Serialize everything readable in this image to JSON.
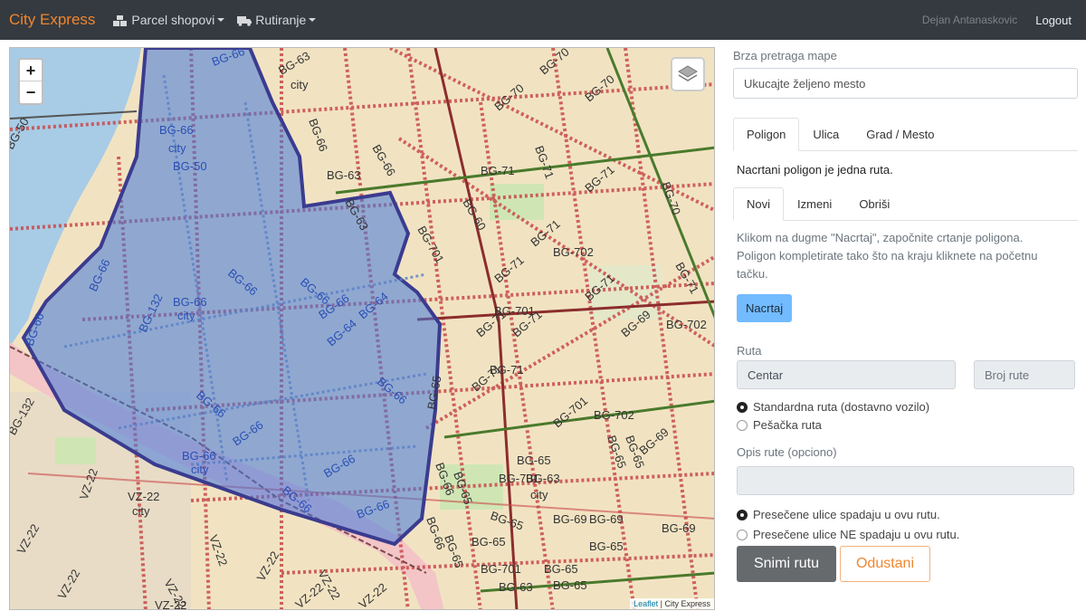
{
  "navbar": {
    "brand": "City Express",
    "menu": [
      {
        "label": "Parcel shopovi",
        "icon": "boxes-icon"
      },
      {
        "label": "Rutiranje",
        "icon": "truck-icon"
      }
    ],
    "user": "Dejan Antanaskovic",
    "logout": "Logout"
  },
  "map": {
    "zoom_in": "+",
    "zoom_out": "−",
    "attribution_link": "Leaflet",
    "attribution_text": " | City Express",
    "route_color": "#3b5ec6",
    "labels": [
      "BG-66",
      "BG-66",
      "BG-66",
      "BG-66",
      "BG-66",
      "BG-66",
      "BG-66",
      "BG-66",
      "BG-64",
      "BG-64",
      "BG-63",
      "BG-63",
      "BG-60",
      "BG-50",
      "BG-132",
      "BG-132",
      "BG-71",
      "BG-71",
      "BG-71",
      "BG-71",
      "BG-71",
      "BG-71",
      "BG-70",
      "BG-70",
      "BG-701",
      "BG-701",
      "BG-701",
      "BG-702",
      "BG-69",
      "BG-69",
      "BG-65",
      "BG-65",
      "BG-65",
      "BG-65",
      "VZ-22",
      "VZ-22",
      "VZ-22",
      "VZ-22",
      "city",
      "city",
      "city"
    ]
  },
  "panel": {
    "search_label": "Brza pretraga mape",
    "search_placeholder": "Ukucajte željeno mesto",
    "main_tabs": [
      "Poligon",
      "Ulica",
      "Grad / Mesto"
    ],
    "polygon_info": "Nacrtani poligon je jedna ruta.",
    "sub_tabs": [
      "Novi",
      "Izmeni",
      "Obriši"
    ],
    "help_text": "Klikom na dugme \"Nacrtaj\", započnite crtanje poligona. Poligon kompletirate tako što na kraju kliknete na početnu tačku.",
    "draw_button": "Nacrtaj",
    "route_label": "Ruta",
    "route_name": "Centar",
    "route_number_placeholder": "Broj rute",
    "route_types": [
      "Standardna ruta (dostavno vozilo)",
      "Pešačka ruta"
    ],
    "route_type_selected": 0,
    "description_label": "Opis rute (opciono)",
    "description_value": "",
    "streets_options": [
      "Presečene ulice spadaju u ovu rutu.",
      "Presečene ulice NE spadaju u ovu rutu."
    ],
    "streets_selected": 0,
    "save_button": "Snimi rutu",
    "cancel_button": "Odustani"
  }
}
